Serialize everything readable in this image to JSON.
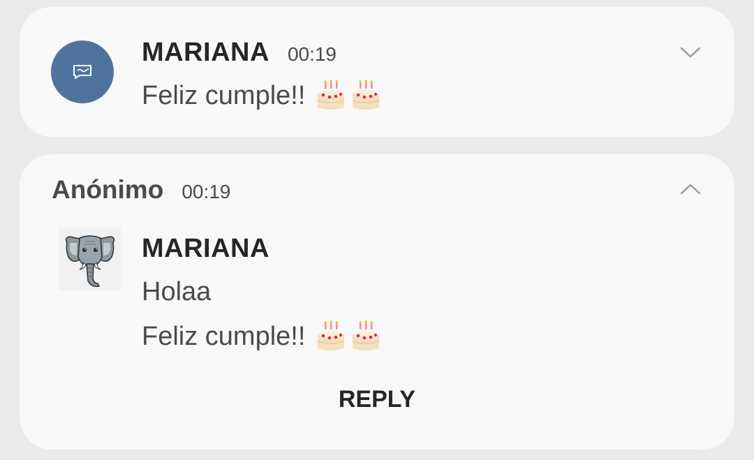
{
  "notification_1": {
    "sender": "MARIANA",
    "time": "00:19",
    "message": "Feliz cumple!!",
    "emojis": [
      "birthday-cake",
      "birthday-cake"
    ],
    "avatar_color": "#4f739d",
    "avatar_icon": "message-bubble-icon",
    "expand_icon": "chevron-down-icon"
  },
  "notification_2": {
    "app_name": "Anónimo",
    "time": "00:19",
    "collapse_icon": "chevron-up-icon",
    "sender": "MARIANA",
    "avatar_icon": "elephant-avatar",
    "messages": [
      {
        "text": "Holaa",
        "emojis": []
      },
      {
        "text": "Feliz cumple!!",
        "emojis": [
          "birthday-cake",
          "birthday-cake"
        ]
      }
    ],
    "reply_label": "REPLY"
  }
}
